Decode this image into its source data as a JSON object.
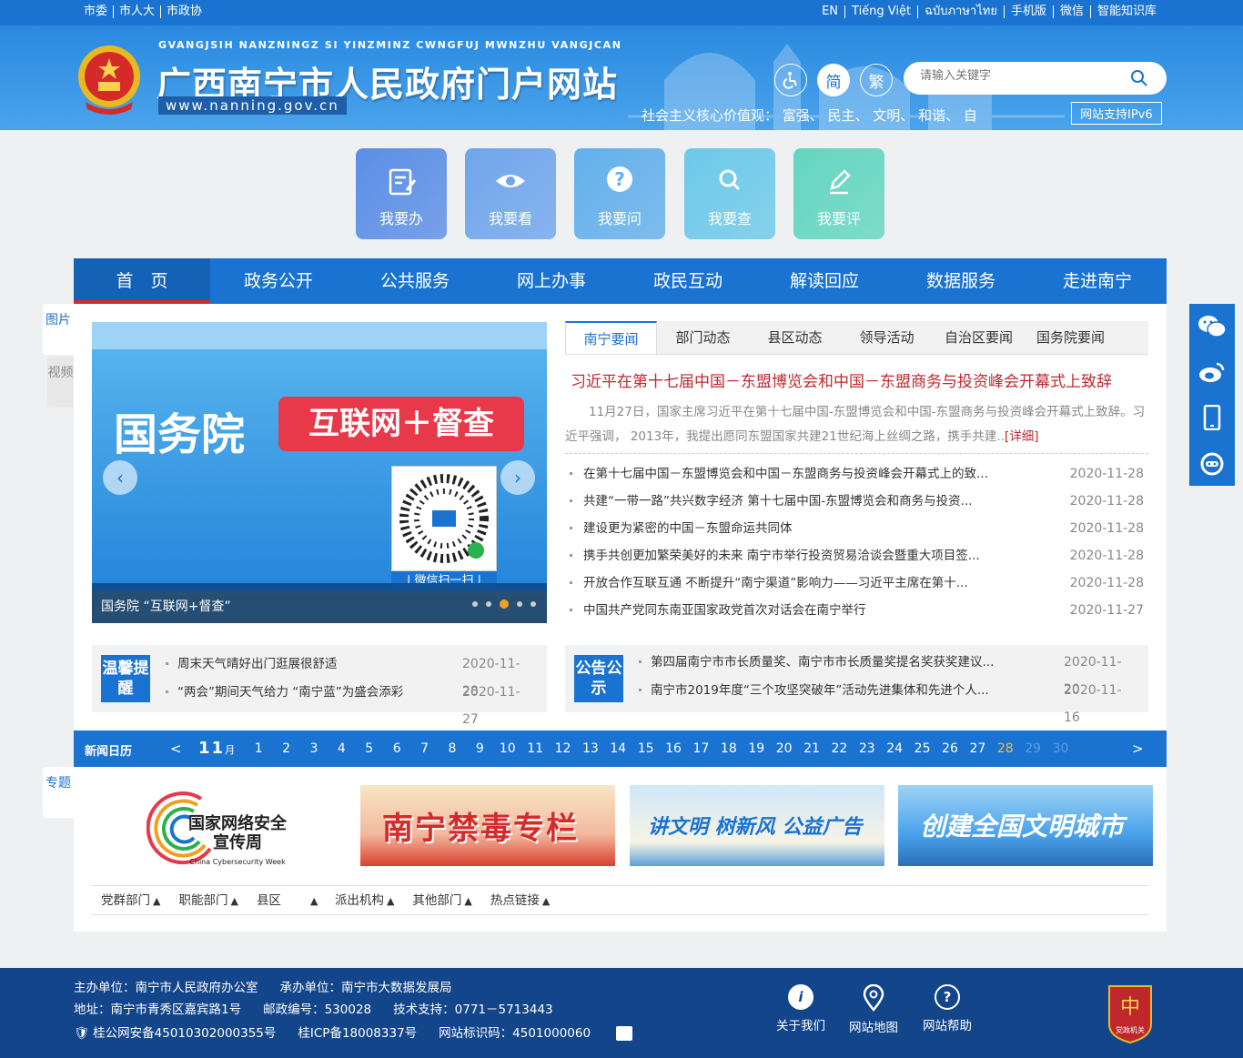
{
  "topbar": {
    "left": [
      "市委",
      "市人大",
      "市政协"
    ],
    "right": [
      "EN",
      "Tiếng Việt",
      "ฉบับภาษาไทย",
      "手机版",
      "微信",
      "智能知识库"
    ]
  },
  "header": {
    "pinyin": "GVANGJSIH NANZNINGZ SI YINZMINZ CWNGFUJ MWNZHU VANGJCAN",
    "title": "广西南宁市人民政府门户网站",
    "url": "www.nanning.gov.cn",
    "btn_simplified": "简",
    "btn_traditional": "繁",
    "search_placeholder": "请输入关键字",
    "values": "社会主义核心价值观：  富强、  民主、  文明、  和谐、  自",
    "ipv6": "网站支持IPv6"
  },
  "quick": [
    {
      "label": "我要办",
      "color": "#5a8ee6"
    },
    {
      "label": "我要看",
      "color": "#6fa5ec"
    },
    {
      "label": "我要问",
      "color": "#62b0ec"
    },
    {
      "label": "我要查",
      "color": "#6cc9ea"
    },
    {
      "label": "我要评",
      "color": "#63d6c0"
    }
  ],
  "nav": [
    "首　页",
    "政务公开",
    "公共服务",
    "网上办事",
    "政民互动",
    "解读回应",
    "数据服务",
    "走进南宁"
  ],
  "sidetabs": {
    "pic": "图片",
    "video": "视频",
    "topic": "专题"
  },
  "slider": {
    "title1": "国务院",
    "title2": "互联网＋督查",
    "scan": "| 微信扫一扫 |",
    "caption": "国务院 “互联网+督查”"
  },
  "tabs": [
    "南宁要闻",
    "部门动态",
    "县区动态",
    "领导活动",
    "自治区要闻",
    "国务院要闻"
  ],
  "headline": "习近平在第十七届中国－东盟博览会和中国－东盟商务与投资峰会开幕式上致辞",
  "summary": "11月27日，国家主席习近平在第十七届中国-东盟博览会和中国-东盟商务与投资峰会开幕式上致辞。习近平强调， 2013年，我提出愿同东盟国家共建21世纪海上丝绸之路，携手共建..",
  "summary_more": "[详细]",
  "news": [
    {
      "title": "在第十七届中国－东盟博览会和中国－东盟商务与投资峰会开幕式上的致...",
      "date": "2020-11-28"
    },
    {
      "title": "共建“一带一路”共兴数字经济 第十七届中国-东盟博览会和商务与投资...",
      "date": "2020-11-28"
    },
    {
      "title": "建设更为紧密的中国－东盟命运共同体",
      "date": "2020-11-28"
    },
    {
      "title": "携手共创更加繁荣美好的未来 南宁市举行投资贸易洽谈会暨重大项目签...",
      "date": "2020-11-28"
    },
    {
      "title": "开放合作互联互通 不断提升“南宁渠道”影响力——习近平主席在第十...",
      "date": "2020-11-28"
    },
    {
      "title": "中国共产党同东南亚国家政党首次对话会在南宁举行",
      "date": "2020-11-27"
    }
  ],
  "tips": {
    "label": "温馨提醒",
    "items": [
      {
        "title": "周末天气晴好出门逛展很舒适",
        "date": "2020-11-28"
      },
      {
        "title": "“两会”期间天气给力 “南宁蓝”为盛会添彩",
        "date": "2020-11-27"
      }
    ]
  },
  "notice": {
    "label": "公告公示",
    "items": [
      {
        "title": "第四届南宁市市长质量奖、南宁市市长质量奖提名奖获奖建议...",
        "date": "2020-11-20"
      },
      {
        "title": "南宁市2019年度“三个攻坚突破年”活动先进集体和先进个人...",
        "date": "2020-11-16"
      }
    ]
  },
  "calendar": {
    "label": "新闻日历",
    "prev": "<",
    "next": ">",
    "month": "11",
    "month_unit": "月",
    "today": 28,
    "days": [
      "1",
      "2",
      "3",
      "4",
      "5",
      "6",
      "7",
      "8",
      "9",
      "10",
      "11",
      "12",
      "13",
      "14",
      "15",
      "16",
      "17",
      "18",
      "19",
      "20",
      "21",
      "22",
      "23",
      "24",
      "25",
      "26",
      "27",
      "28",
      "29",
      "30"
    ]
  },
  "banners": {
    "b1_line1": "国家网络安全",
    "b1_line2": "宣传周",
    "b1_en": "China Cybersecurity Week",
    "b2": "南宁禁毒专栏",
    "b3": "讲文明 树新风 公益广告",
    "b4": "创建全国文明城市"
  },
  "links": [
    "党群部门",
    "职能部门",
    "县区",
    "派出机构",
    "其他部门",
    "热点链接"
  ],
  "footer": {
    "line1": [
      "主办单位：南宁市人民政府办公室",
      "承办单位：南宁市大数据发展局"
    ],
    "line2": [
      "地址：南宁市青秀区嘉宾路1号",
      "邮政编号：530028",
      "技术支持：0771－5713443"
    ],
    "line3": [
      "桂公网安备45010302000355号",
      "桂ICP备18008337号",
      "网站标识码：4501000060"
    ],
    "about": "关于我们",
    "map": "网站地图",
    "help": "网站帮助",
    "party": "党政机关"
  }
}
